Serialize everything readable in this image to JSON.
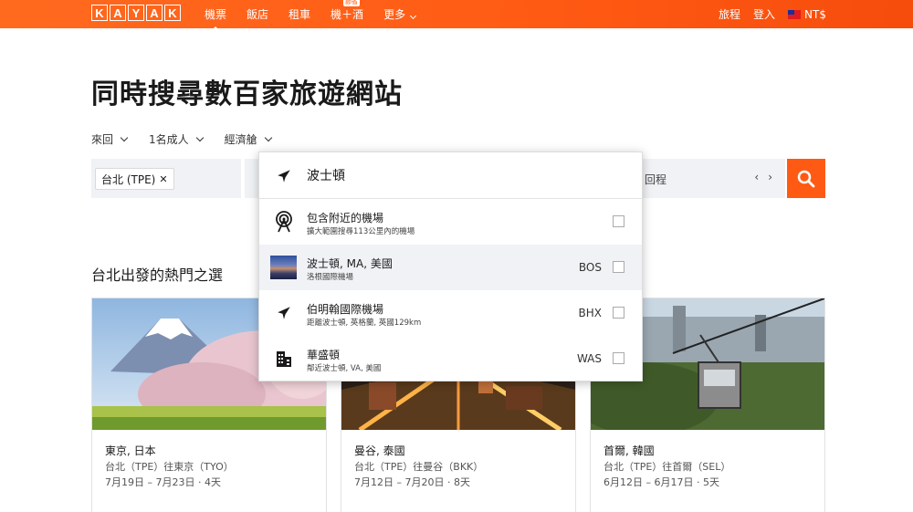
{
  "header": {
    "logo_letters": [
      "K",
      "A",
      "Y",
      "A",
      "K"
    ],
    "nav": [
      {
        "label": "機票",
        "active": true
      },
      {
        "label": "飯店",
        "active": false
      },
      {
        "label": "租車",
        "active": false
      },
      {
        "label": "機＋酒",
        "active": false,
        "badge": "節省"
      },
      {
        "label": "更多",
        "active": false
      }
    ],
    "trips": "旅程",
    "login": "登入",
    "currency": "NT$"
  },
  "page_title": "同時搜尋數百家旅遊網站",
  "options": {
    "trip_type": "來回",
    "travelers": "1名成人",
    "cabin": "經濟艙"
  },
  "search": {
    "origin_chip": "台北 (TPE)",
    "date_return": "回程",
    "date_prev": "‹",
    "date_next": "›"
  },
  "dropdown": {
    "query": "波士頓",
    "items": [
      {
        "title": "包含附近的機場",
        "subtitle": "擴大範圍搜尋113公里內的機場",
        "code": "",
        "icon": "radar-icon",
        "highlighted": false
      },
      {
        "title": "波士頓, MA, 美國",
        "subtitle": "洛根國際機場",
        "code": "BOS",
        "icon": "city-thumbnail",
        "highlighted": true
      },
      {
        "title": "伯明翰國際機場",
        "subtitle": "距離波士頓, 英格蘭, 英國129km",
        "code": "BHX",
        "icon": "plane-icon",
        "highlighted": false
      },
      {
        "title": "華盛頓",
        "subtitle": "鄰近波士頓, VA, 美國",
        "code": "WAS",
        "icon": "building-icon",
        "highlighted": false
      }
    ]
  },
  "popular": {
    "title": "台北出發的熱門之選",
    "cards": [
      {
        "city": "東京, 日本",
        "route": "台北（TPE）往東京（TYO）",
        "dates": "7月19日 – 7月23日 · 4天"
      },
      {
        "city": "曼谷, 泰國",
        "route": "台北（TPE）往曼谷（BKK）",
        "dates": "7月12日 – 7月20日 · 8天"
      },
      {
        "city": "首爾, 韓國",
        "route": "台北（TPE）往首爾（SEL）",
        "dates": "6月12日 – 6月17日 · 5天"
      }
    ]
  },
  "colors": {
    "brand": "#ff5a14",
    "field_bg": "#f0f2f5"
  }
}
